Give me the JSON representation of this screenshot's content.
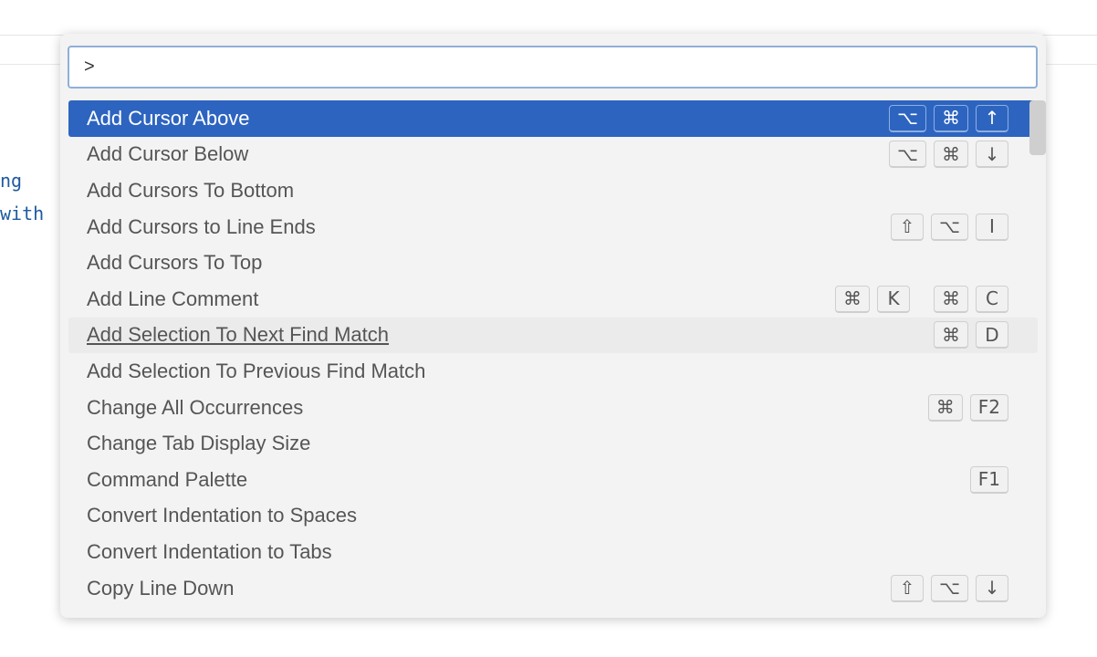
{
  "editor": {
    "code_lines": [
      "ng",
      "with"
    ]
  },
  "palette": {
    "input_value": ">",
    "items": [
      {
        "label": "Add Cursor Above",
        "keys": [
          [
            "⌥",
            "⌘",
            "↑"
          ]
        ]
      },
      {
        "label": "Add Cursor Below",
        "keys": [
          [
            "⌥",
            "⌘",
            "↓"
          ]
        ]
      },
      {
        "label": "Add Cursors To Bottom",
        "keys": []
      },
      {
        "label": "Add Cursors to Line Ends",
        "keys": [
          [
            "⇧",
            "⌥",
            "I"
          ]
        ]
      },
      {
        "label": "Add Cursors To Top",
        "keys": []
      },
      {
        "label": "Add Line Comment",
        "keys": [
          [
            "⌘",
            "K"
          ],
          [
            "⌘",
            "C"
          ]
        ]
      },
      {
        "label": "Add Selection To Next Find Match",
        "keys": [
          [
            "⌘",
            "D"
          ]
        ]
      },
      {
        "label": "Add Selection To Previous Find Match",
        "keys": []
      },
      {
        "label": "Change All Occurrences",
        "keys": [
          [
            "⌘",
            "F2"
          ]
        ]
      },
      {
        "label": "Change Tab Display Size",
        "keys": []
      },
      {
        "label": "Command Palette",
        "keys": [
          [
            "F1"
          ]
        ]
      },
      {
        "label": "Convert Indentation to Spaces",
        "keys": []
      },
      {
        "label": "Convert Indentation to Tabs",
        "keys": []
      },
      {
        "label": "Copy Line Down",
        "keys": [
          [
            "⇧",
            "⌥",
            "↓"
          ]
        ]
      }
    ],
    "selected_index": 0,
    "hovered_index": 6
  }
}
